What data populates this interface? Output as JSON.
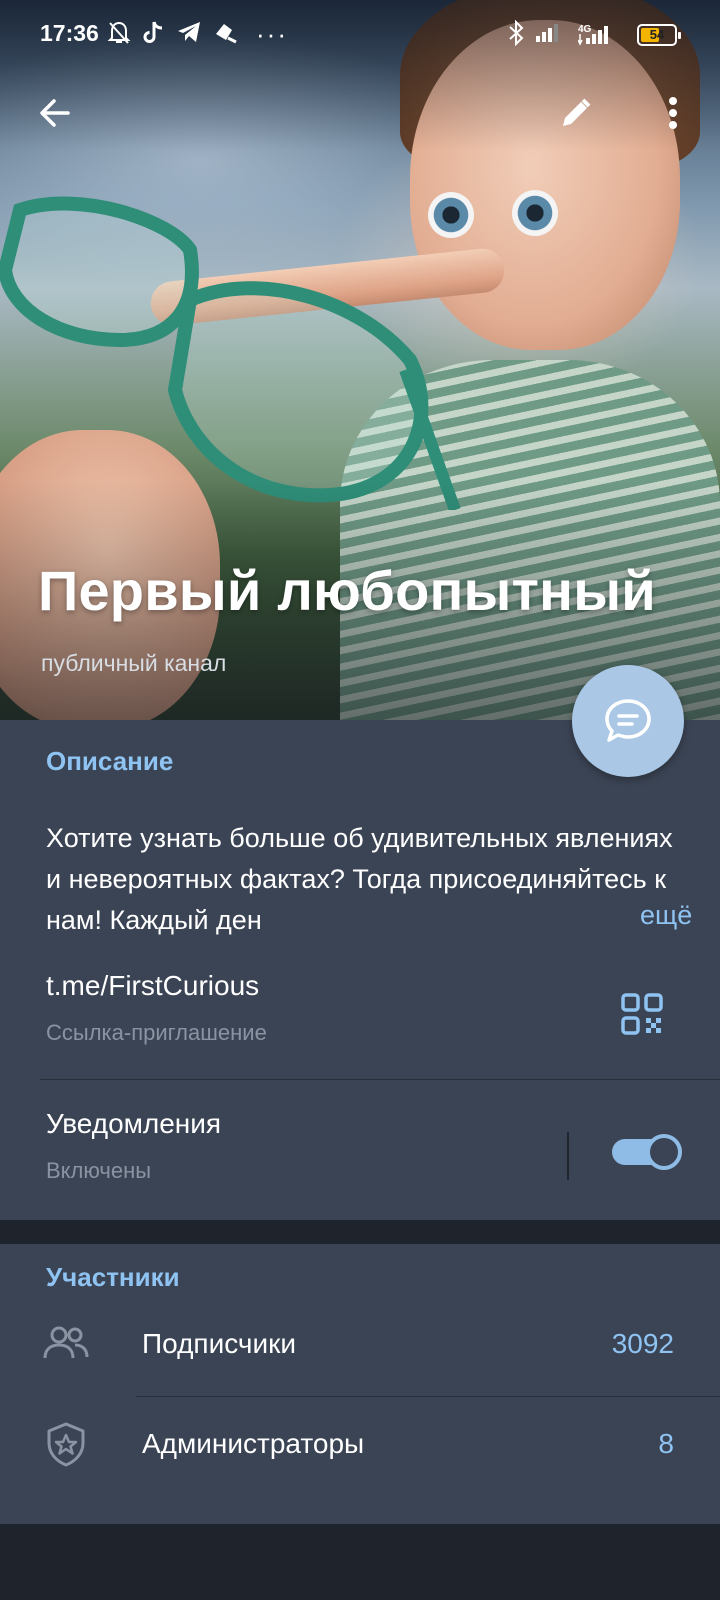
{
  "status_bar": {
    "time": "17:36",
    "battery": "54",
    "network": "4G"
  },
  "header": {
    "back_icon": "arrow-left-icon",
    "edit_icon": "pencil-icon",
    "more_icon": "more-vertical-icon"
  },
  "channel": {
    "title": "Первый любопытный",
    "subtitle": "публичный канал"
  },
  "info": {
    "description_label": "Описание",
    "description": "Хотите узнать больше об удивительных явлениях и невероятных фактах? Тогда присоединяйтесь к нам! Каждый ден",
    "more_label": "ещё",
    "link": "t.me/FirstCurious",
    "link_caption": "Ссылка-приглашение",
    "notifications_label": "Уведомления",
    "notifications_state": "Включены",
    "notifications_on": true
  },
  "members": {
    "section_label": "Участники",
    "rows": [
      {
        "label": "Подписчики",
        "count": "3092",
        "icon": "people-icon"
      },
      {
        "label": "Администраторы",
        "count": "8",
        "icon": "shield-star-icon"
      }
    ]
  },
  "colors": {
    "accent": "#8fc3f2",
    "panel": "#3b4454",
    "background": "#1f232c",
    "fab": "#aac8e6"
  }
}
